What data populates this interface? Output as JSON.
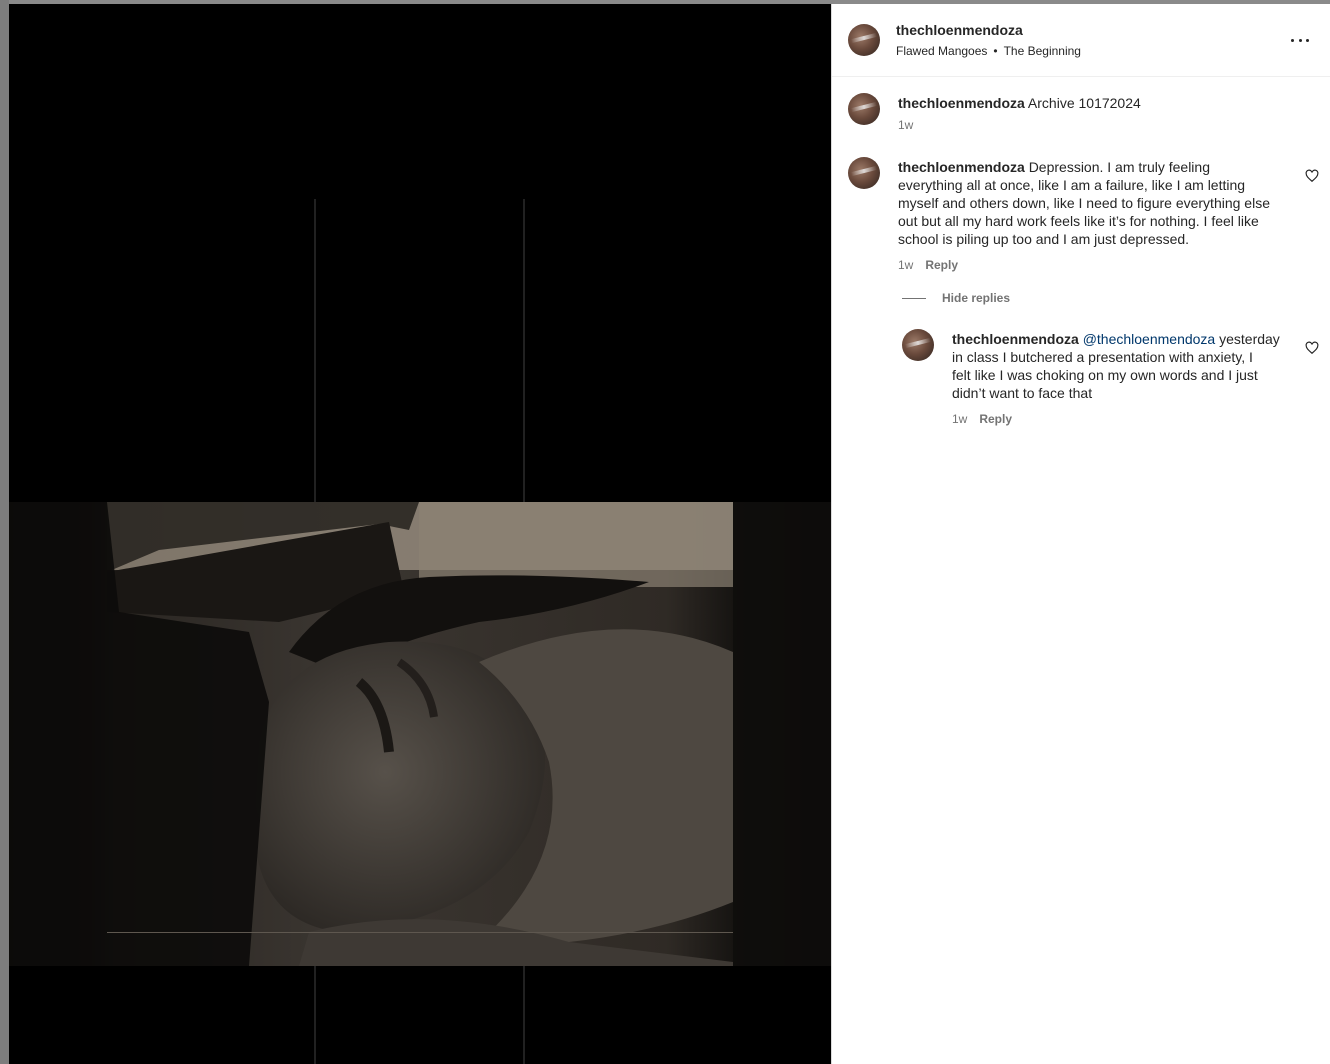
{
  "post": {
    "author": "thechloenmendoza",
    "song": "Flawed Mangoes",
    "separator": "•",
    "track": "The Beginning"
  },
  "caption": {
    "username": "thechloenmendoza",
    "text": "Archive 10172024",
    "time": "1w"
  },
  "comments": [
    {
      "username": "thechloenmendoza",
      "lines": [
        "Depression. I am truly feeling",
        "everything all at once, like I am a failure, like I am letting",
        "myself and others down, like I need to figure everything else",
        "out but all my hard work feels like it’s for nothing. I feel like",
        "school is piling up too and I am just depressed."
      ],
      "time": "1w",
      "reply_label": "Reply"
    }
  ],
  "hide_replies_label": "Hide replies",
  "reply": {
    "username": "thechloenmendoza",
    "mention": "@thechloenmendoza",
    "first_line_rest": "yesterday",
    "lines": [
      "in class I butchered a presentation with anxiety, I",
      "felt like I was choking on my own words and I just",
      "didn’t want to face that"
    ],
    "time": "1w",
    "reply_label": "Reply"
  },
  "icons": {
    "more": "more-options-icon",
    "like": "heart-icon"
  }
}
